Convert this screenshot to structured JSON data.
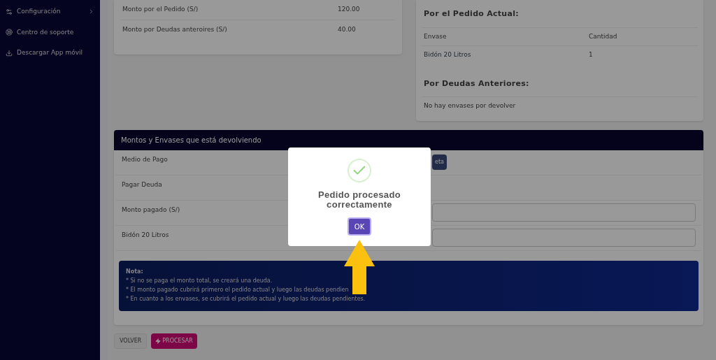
{
  "sidebar": {
    "items": [
      {
        "label": "Configuración",
        "has_submenu": true
      },
      {
        "label": "Centro de soporte",
        "has_submenu": false
      },
      {
        "label": "Descargar App móvil",
        "has_submenu": false
      }
    ]
  },
  "amounts_card": {
    "rows": [
      {
        "label": "Monto por el Pedido (S/)",
        "value": "120.00"
      },
      {
        "label": "Monto por Deudas anteroires (S/)",
        "value": "40.00"
      }
    ]
  },
  "containers_card": {
    "current_title": "Por el Pedido Actual:",
    "columns": [
      "Envase",
      "Cantidad"
    ],
    "rows": [
      {
        "envase": "Bidón 20 Litros",
        "cantidad": "1"
      }
    ],
    "previous_title": "Por Deudas Anteriores:",
    "previous_empty": "No hay envases por devolver"
  },
  "return_card": {
    "title": "Montos y Envases que está devolviendo",
    "fields": [
      {
        "kind": "choice",
        "label": "Medio de Pago",
        "button": "eta"
      },
      {
        "kind": "plain",
        "label": "Pagar Deuda"
      },
      {
        "kind": "input",
        "label": "Monto pagado (S/)"
      },
      {
        "kind": "input",
        "label": "Bidón 20 Litros"
      }
    ],
    "note_title": "Nota:",
    "note_lines": [
      "* Si no se paga el monto total, se creará una deuda.",
      "* El monto pagado cubrirá primero el pedido actual y luego las deudas pendien",
      "* En cuanto a los envases, se cubrirá el pedido actual y luego las deudas pendientes."
    ]
  },
  "buttons": [
    {
      "kind": "secondary",
      "label": "VOLVER"
    },
    {
      "kind": "primary",
      "label": "PROCESAR"
    }
  ],
  "dialog": {
    "message": "Pedido procesado correctamente",
    "button": "OK"
  }
}
